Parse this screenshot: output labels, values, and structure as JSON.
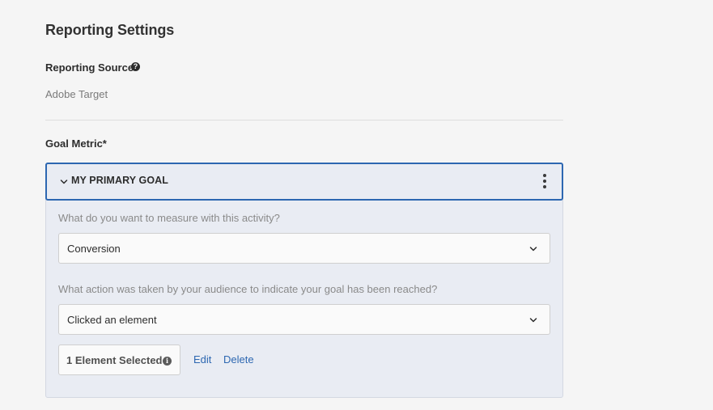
{
  "reporting": {
    "title": "Reporting Settings",
    "source_label": "Reporting Source",
    "source_help_icon": "question-circle-icon",
    "source_value": "Adobe Target"
  },
  "goal": {
    "label": "Goal Metric*",
    "panel_title": "MY PRIMARY GOAL",
    "collapse_icon": "chevron-down-icon",
    "more_icon": "more-vertical-icon",
    "question_measure": "What do you want to measure with this activity?",
    "measure_value": "Conversion",
    "question_action": "What action was taken by your audience to indicate your goal has been reached?",
    "action_value": "Clicked an element",
    "element_selected": "1 Element Selected",
    "element_info_icon": "info-icon",
    "edit_label": "Edit",
    "delete_label": "Delete"
  },
  "colors": {
    "accent": "#2d67b1",
    "panel_bg": "#e9ecf3",
    "page_bg": "#f5f5f5"
  }
}
